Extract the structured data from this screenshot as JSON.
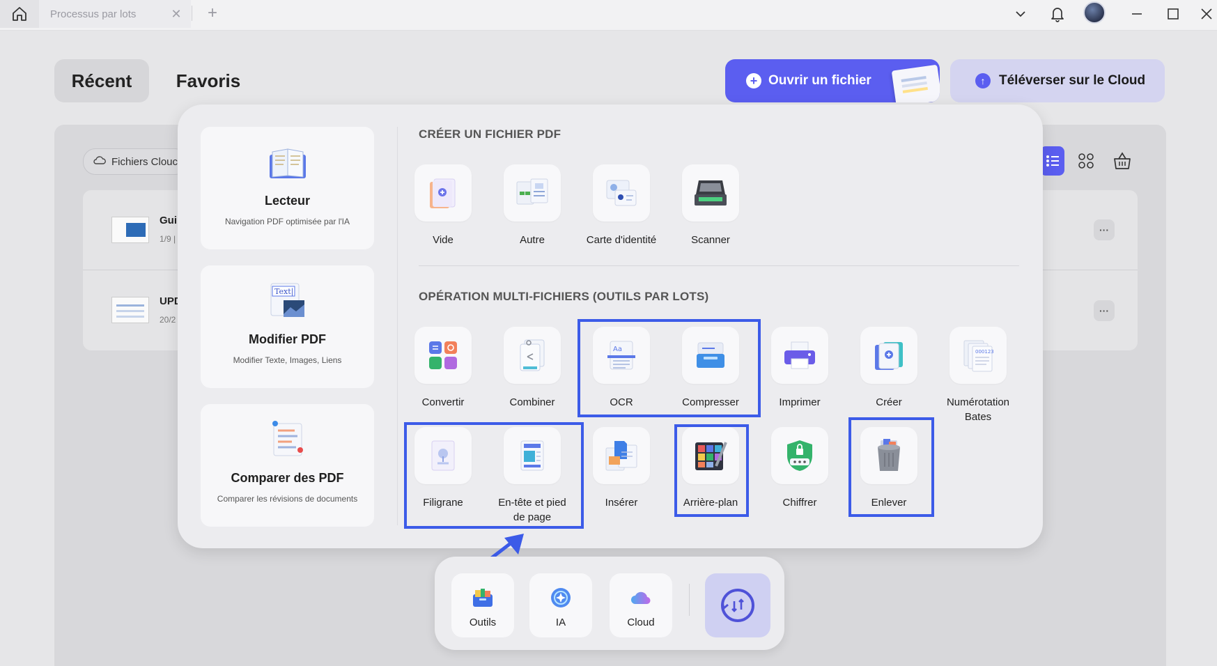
{
  "titlebar": {
    "tab_title": "Processus par lots",
    "icons": [
      "home-icon",
      "close-icon",
      "plus-icon",
      "chevron-down-icon",
      "bell-icon",
      "minimize-icon",
      "maximize-icon",
      "close-window-icon"
    ]
  },
  "header": {
    "tab_recent": "Récent",
    "tab_favorites": "Favoris",
    "open_file": "Ouvrir un fichier",
    "upload_cloud": "Téléverser sur le Cloud",
    "accent_color": "#5b5ef0"
  },
  "files": {
    "cloud_chip": "Fichiers Clouc",
    "rows": [
      {
        "name": "Gui",
        "meta": "1/9 |"
      },
      {
        "name": "UPD",
        "meta": "20/2"
      }
    ],
    "more": "···"
  },
  "features": [
    {
      "title": "Lecteur",
      "subtitle": "Navigation PDF optimisée par l'IA",
      "icon": "book-icon"
    },
    {
      "title": "Modifier PDF",
      "subtitle": "Modifier Texte, Images, Liens",
      "icon": "edit-text-icon",
      "badge": "Text|"
    },
    {
      "title": "Comparer des PDF",
      "subtitle": "Comparer les révisions de documents",
      "icon": "compare-icon"
    }
  ],
  "create": {
    "title": "CRÉER UN FICHIER PDF",
    "tools": [
      {
        "label": "Vide",
        "icon": "blank-page-icon"
      },
      {
        "label": "Autre",
        "icon": "other-files-icon"
      },
      {
        "label": "Carte d'identité",
        "icon": "id-card-icon"
      },
      {
        "label": "Scanner",
        "icon": "scanner-icon"
      }
    ]
  },
  "batch": {
    "title": "OPÉRATION MULTI-FICHIERS (OUTILS PAR LOTS)",
    "tools": [
      {
        "label": "Convertir",
        "icon": "convert-icon"
      },
      {
        "label": "Combiner",
        "icon": "combine-icon"
      },
      {
        "label": "OCR",
        "icon": "ocr-icon"
      },
      {
        "label": "Compresser",
        "icon": "compress-icon"
      },
      {
        "label": "Imprimer",
        "icon": "printer-icon"
      },
      {
        "label": "Créer",
        "icon": "create-icon"
      },
      {
        "label": "Numérotation Bates",
        "icon": "bates-icon"
      },
      {
        "label": "Filigrane",
        "icon": "watermark-icon"
      },
      {
        "label": "En-tête et pied de page",
        "icon": "header-footer-icon"
      },
      {
        "label": "Insérer",
        "icon": "insert-icon"
      },
      {
        "label": "Arrière-plan",
        "icon": "background-icon"
      },
      {
        "label": "Chiffrer",
        "icon": "encrypt-icon"
      },
      {
        "label": "Enlever",
        "icon": "remove-icon"
      }
    ],
    "highlighted": [
      "OCR",
      "Compresser",
      "Filigrane",
      "En-tête et pied de page",
      "Arrière-plan",
      "Enlever"
    ]
  },
  "dock": {
    "items": [
      {
        "label": "Outils",
        "icon": "toolbox-icon"
      },
      {
        "label": "IA",
        "icon": "ai-icon"
      },
      {
        "label": "Cloud",
        "icon": "cloud-icon"
      }
    ],
    "history_icon": "history-icon"
  },
  "annotation_color": "#3c5be8"
}
